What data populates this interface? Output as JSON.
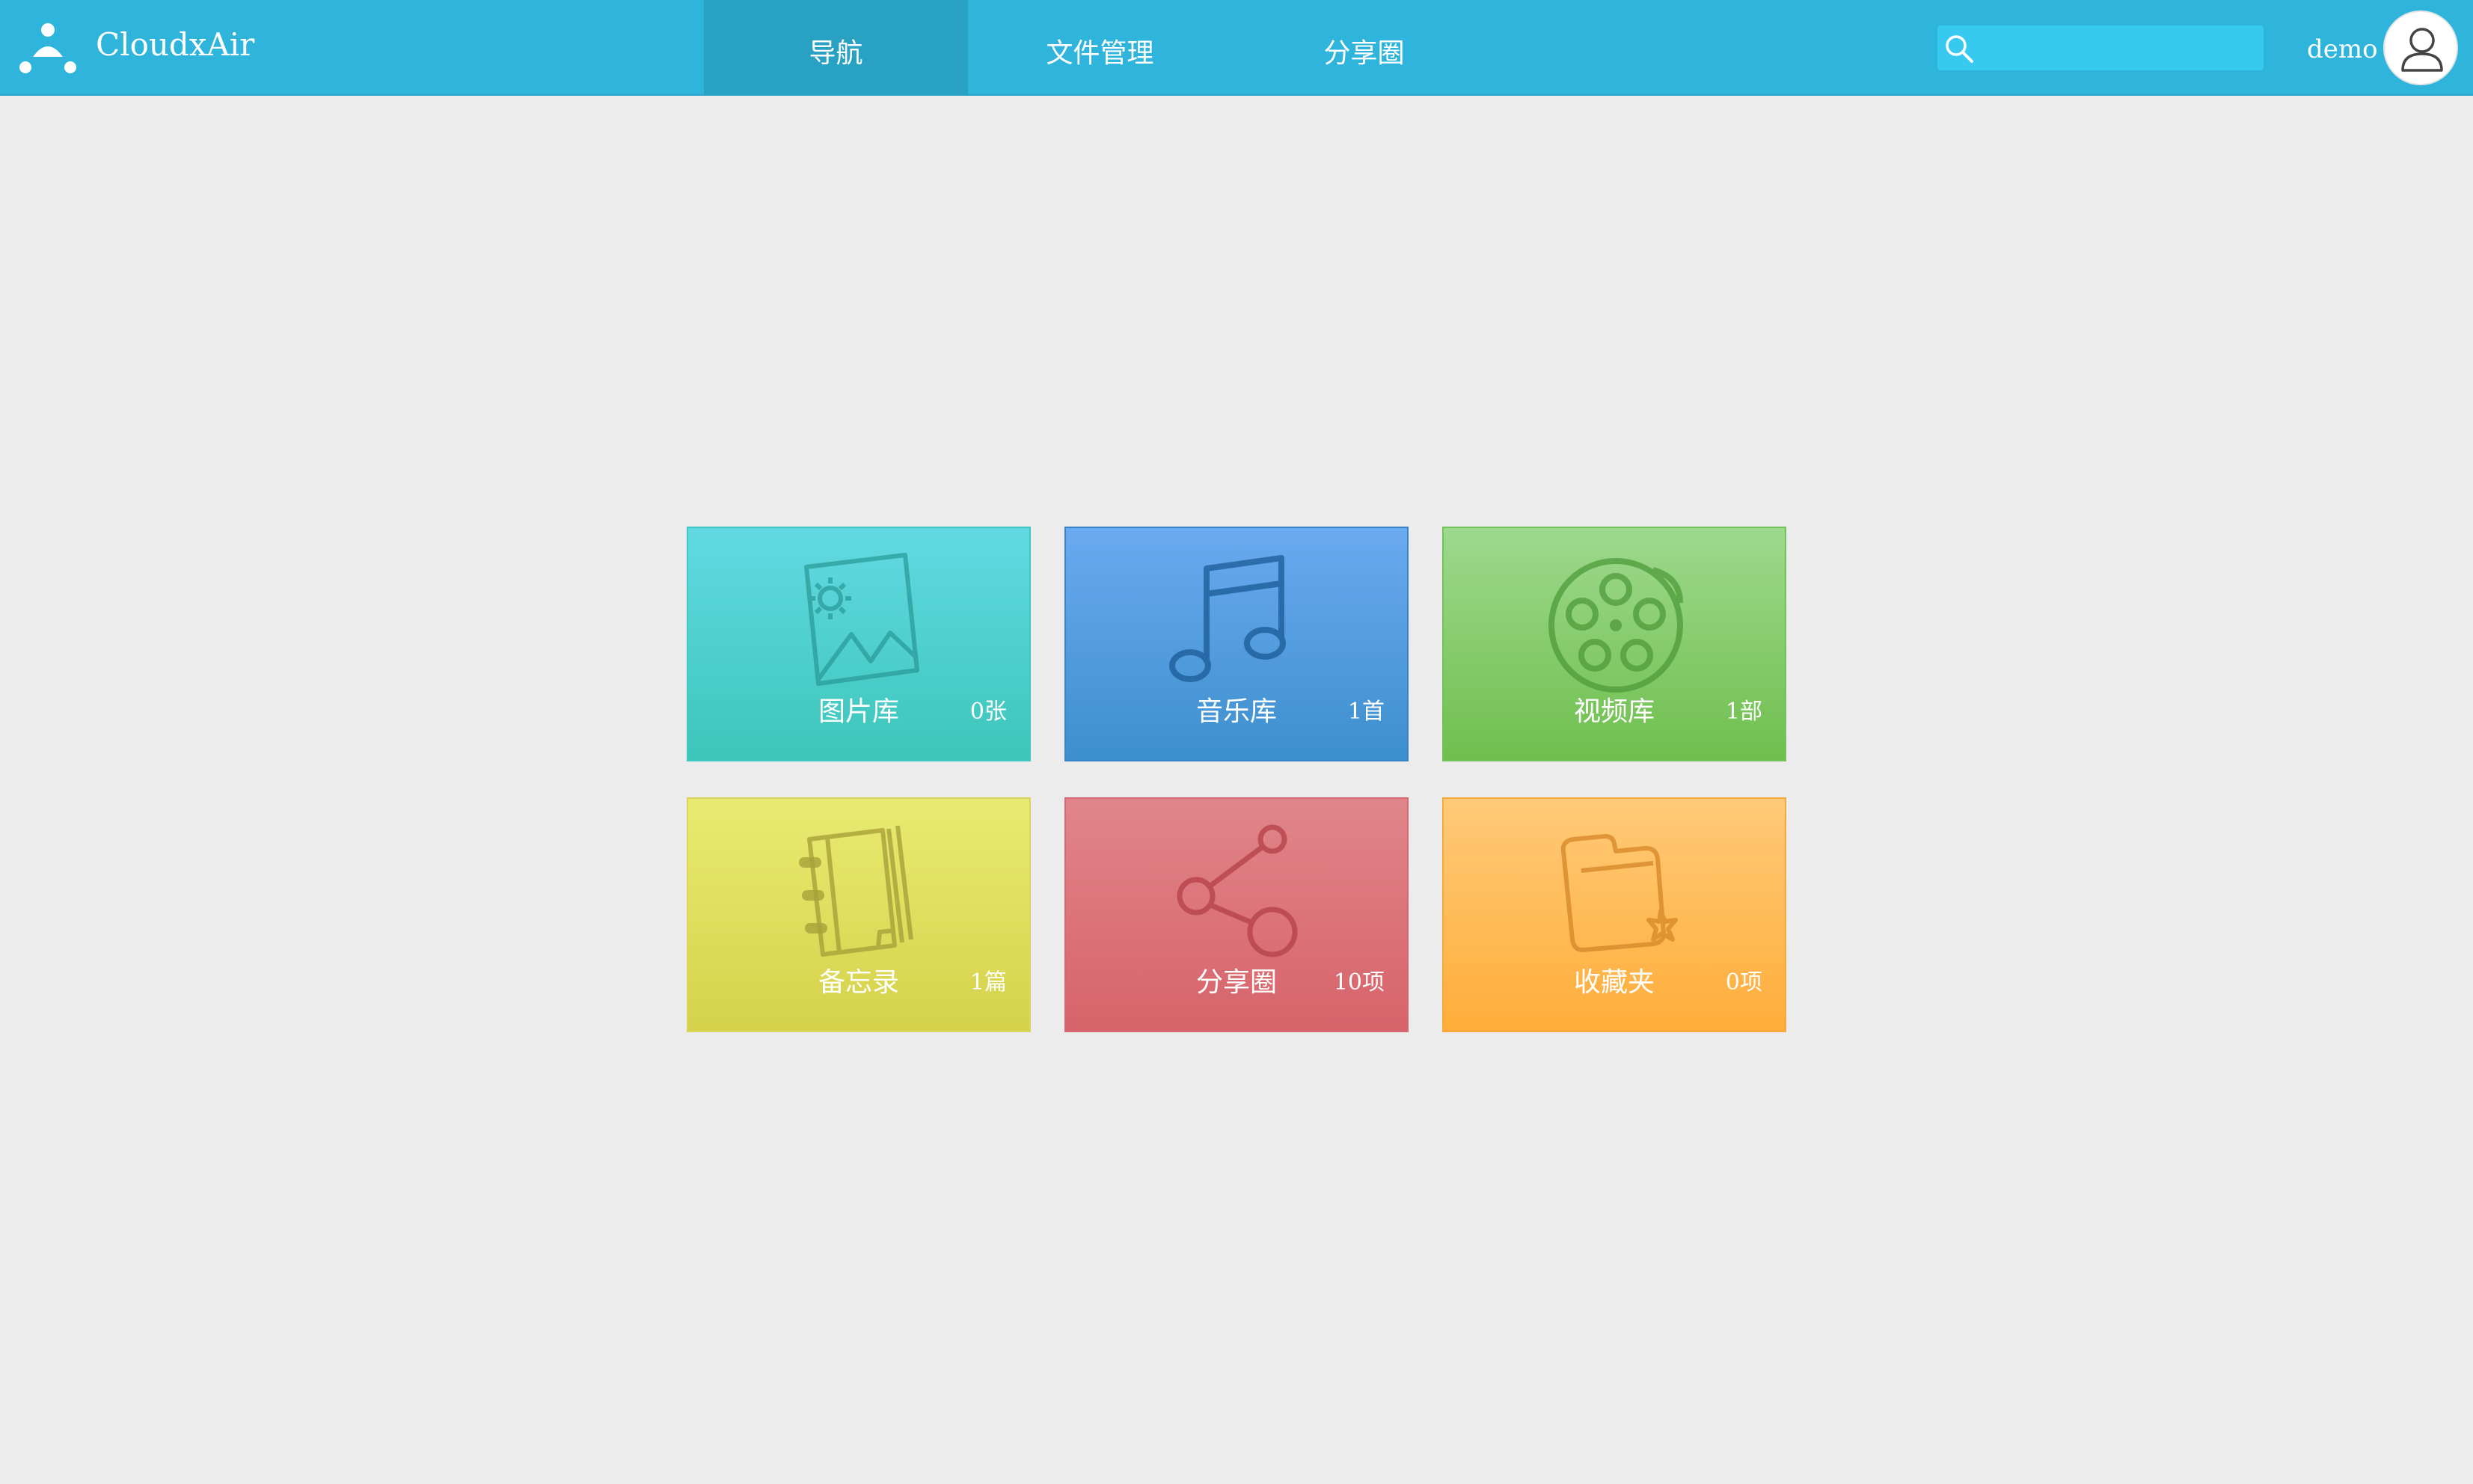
{
  "header": {
    "app_title": "CloudxAir",
    "logo_icon": "cluster-dots-icon",
    "nav": [
      {
        "label": "导航",
        "active": true
      },
      {
        "label": "文件管理",
        "active": false
      },
      {
        "label": "分享圈",
        "active": false
      }
    ],
    "search": {
      "value": "",
      "placeholder": "",
      "icon": "search-icon"
    },
    "user": {
      "name": "demo",
      "avatar_icon": "user-avatar-icon"
    }
  },
  "tiles": [
    {
      "label": "图片库",
      "count": "0张",
      "icon": "picture-icon",
      "color": "#4ccfd0"
    },
    {
      "label": "音乐库",
      "count": "1首",
      "icon": "music-note-icon",
      "color": "#569ee3"
    },
    {
      "label": "视频库",
      "count": "1部",
      "icon": "film-reel-icon",
      "color": "#86cc6e"
    },
    {
      "label": "备忘录",
      "count": "1篇",
      "icon": "notebook-icon",
      "color": "#dfe05e"
    },
    {
      "label": "分享圈",
      "count": "10项",
      "icon": "share-icon",
      "color": "#dc757a"
    },
    {
      "label": "收藏夹",
      "count": "0项",
      "icon": "favorite-folder-icon",
      "color": "#ffbb58"
    }
  ],
  "colors": {
    "header_bg": "#2fb5dc",
    "active_tab_bg": "#28a1c3",
    "search_bg": "#38c9f1",
    "page_bg": "#ececec"
  }
}
